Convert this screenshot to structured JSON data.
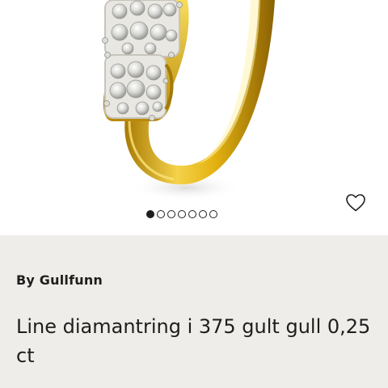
{
  "product": {
    "brand": "By Gullfunn",
    "title": "Line diamantring i 375 gult gull 0,25 ct"
  },
  "gallery": {
    "image_count": 7,
    "active_index": 0,
    "image_subject": "ring-image"
  },
  "wishlist": {
    "icon": "heart-outline-icon"
  },
  "colors": {
    "info_background": "#efede9",
    "text": "#1e1e1e",
    "gold": "#e2b20f",
    "image_background": "#ffffff"
  }
}
